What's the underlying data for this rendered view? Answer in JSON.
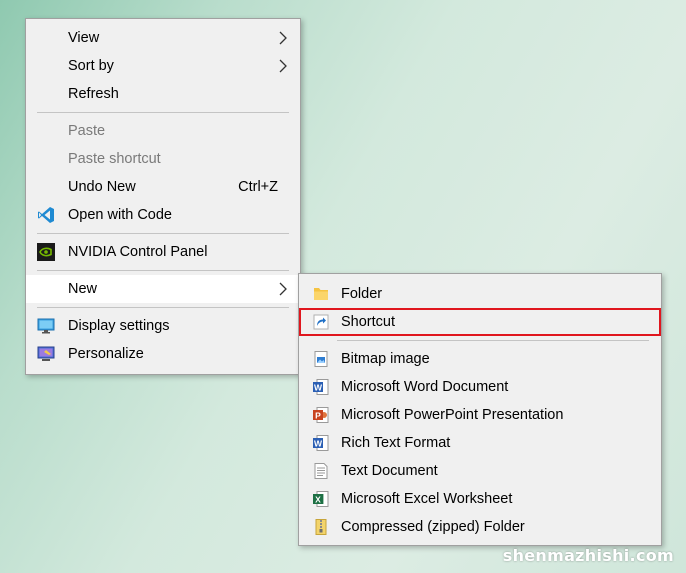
{
  "main_menu": {
    "view": "View",
    "sort_by": "Sort by",
    "refresh": "Refresh",
    "paste": "Paste",
    "paste_shortcut": "Paste shortcut",
    "undo_new": "Undo New",
    "undo_new_shortcut": "Ctrl+Z",
    "open_with_code": "Open with Code",
    "nvidia": "NVIDIA Control Panel",
    "new": "New",
    "display_settings": "Display settings",
    "personalize": "Personalize"
  },
  "new_submenu": {
    "folder": "Folder",
    "shortcut": "Shortcut",
    "bitmap": "Bitmap image",
    "word": "Microsoft Word Document",
    "powerpoint": "Microsoft PowerPoint Presentation",
    "rtf": "Rich Text Format",
    "text": "Text Document",
    "excel": "Microsoft Excel Worksheet",
    "zip": "Compressed (zipped) Folder"
  },
  "colors": {
    "highlight_border": "#e0161e",
    "menu_bg": "#f0f0f0",
    "hover_bg": "#ffffff"
  },
  "icons": [
    "vscode-icon",
    "nvidia-icon",
    "display-icon",
    "personalize-icon",
    "folder-icon",
    "shortcut-icon",
    "bitmap-icon",
    "word-icon",
    "powerpoint-icon",
    "rtf-icon",
    "text-document-icon",
    "excel-icon",
    "zip-folder-icon"
  ],
  "watermark": "shenmazhishi.com"
}
